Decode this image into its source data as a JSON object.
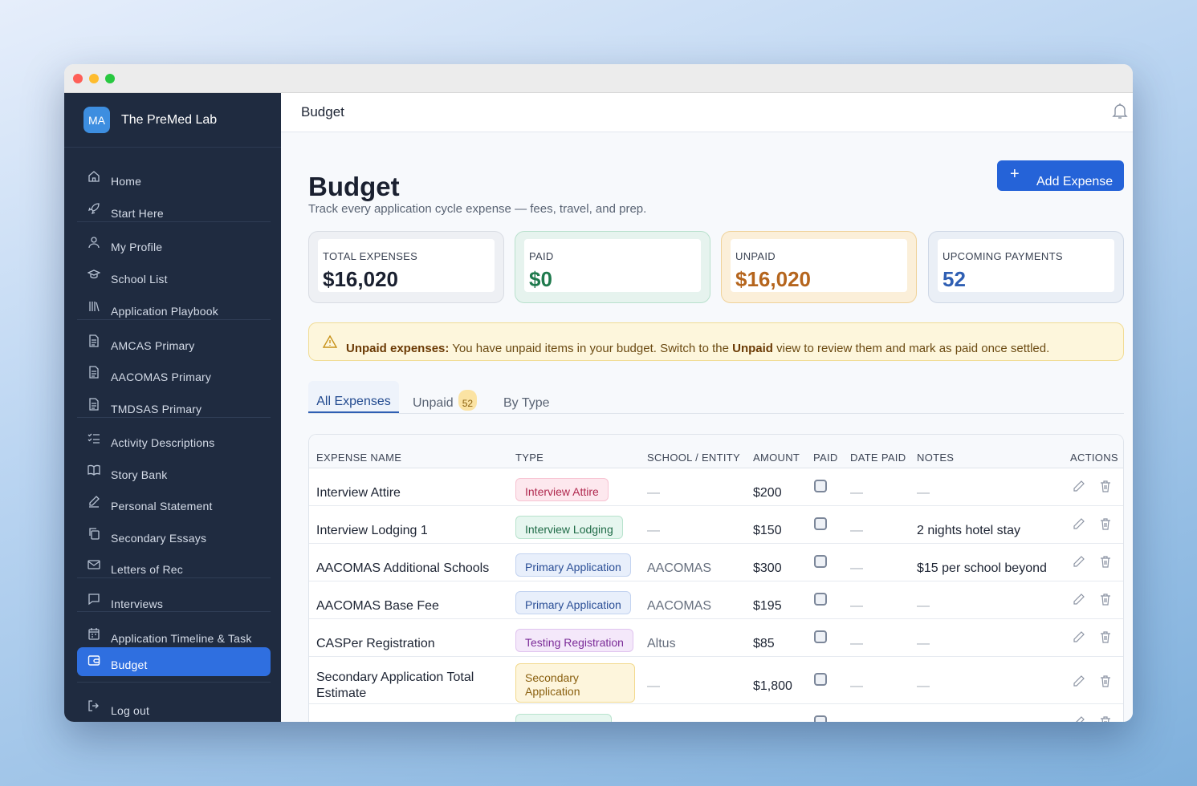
{
  "brand": {
    "initials": "MA",
    "name": "The PreMed Lab"
  },
  "sidebar": {
    "items": [
      {
        "label": "Home",
        "icon": "home-icon"
      },
      {
        "label": "Start Here",
        "icon": "rocket-icon"
      },
      {
        "label": "My Profile",
        "icon": "user-icon"
      },
      {
        "label": "School List",
        "icon": "graduation-cap-icon"
      },
      {
        "label": "Application Playbook",
        "icon": "library-icon"
      },
      {
        "label": "AMCAS Primary",
        "icon": "document-icon"
      },
      {
        "label": "AACOMAS Primary",
        "icon": "document-icon"
      },
      {
        "label": "TMDSAS Primary",
        "icon": "document-icon"
      },
      {
        "label": "Activity Descriptions",
        "icon": "checklist-icon"
      },
      {
        "label": "Story Bank",
        "icon": "book-icon"
      },
      {
        "label": "Personal Statement",
        "icon": "pen-icon"
      },
      {
        "label": "Secondary Essays",
        "icon": "copy-icon"
      },
      {
        "label": "Letters of Rec",
        "icon": "mail-icon"
      },
      {
        "label": "Interviews",
        "icon": "chat-icon"
      },
      {
        "label": "Application Timeline & Task",
        "icon": "calendar-icon"
      },
      {
        "label": "Budget",
        "icon": "wallet-icon",
        "active": true
      },
      {
        "label": "Log out",
        "icon": "logout-icon"
      }
    ]
  },
  "topbar": {
    "title": "Budget"
  },
  "page": {
    "title": "Budget",
    "subtitle": "Track every application cycle expense — fees, travel, and prep.",
    "add_button": "Add Expense"
  },
  "stats": [
    {
      "label": "TOTAL EXPENSES",
      "value": "$16,020",
      "color": "#1a2030"
    },
    {
      "label": "PAID",
      "value": "$0",
      "color": "#1f7a4d"
    },
    {
      "label": "UNPAID",
      "value": "$16,020",
      "color": "#b5651d"
    },
    {
      "label": "UPCOMING PAYMENTS",
      "value": "52",
      "color": "#2f5fb3"
    }
  ],
  "alert": {
    "bold_lead": "Unpaid expenses:",
    "text_1": " You have unpaid items in your budget. Switch to the ",
    "bold_mid": "Unpaid",
    "text_2": " view to review them and mark as paid once settled."
  },
  "tabs": [
    {
      "label": "All Expenses",
      "active": true
    },
    {
      "label": "Unpaid",
      "badge": "52"
    },
    {
      "label": "By Type"
    }
  ],
  "table": {
    "headers": [
      "EXPENSE NAME",
      "TYPE",
      "SCHOOL / ENTITY",
      "AMOUNT",
      "PAID",
      "DATE PAID",
      "NOTES",
      "ACTIONS"
    ],
    "rows": [
      {
        "name": "Interview Attire",
        "type": "Interview Attire",
        "type_color": "pink",
        "entity": "—",
        "amount": "$200",
        "date_paid": "—",
        "notes": "—"
      },
      {
        "name": "Interview Lodging 1",
        "type": "Interview Lodging",
        "type_color": "green",
        "entity": "—",
        "amount": "$150",
        "date_paid": "—",
        "notes": "2 nights hotel stay"
      },
      {
        "name": "AACOMAS Additional Schools",
        "type": "Primary Application",
        "type_color": "blue",
        "entity": "AACOMAS",
        "amount": "$300",
        "date_paid": "—",
        "notes": "$15 per school beyond"
      },
      {
        "name": "AACOMAS Base Fee",
        "type": "Primary Application",
        "type_color": "blue",
        "entity": "AACOMAS",
        "amount": "$195",
        "date_paid": "—",
        "notes": "—"
      },
      {
        "name": "CASPer Registration",
        "type": "Testing Registration",
        "type_color": "purple",
        "entity": "Altus",
        "amount": "$85",
        "date_paid": "—",
        "notes": "—"
      },
      {
        "name": "Secondary Application Total Estimate",
        "type": "Secondary Application",
        "type_color": "yellow",
        "entity": "—",
        "amount": "$1,800",
        "date_paid": "—",
        "notes": "—"
      }
    ]
  }
}
